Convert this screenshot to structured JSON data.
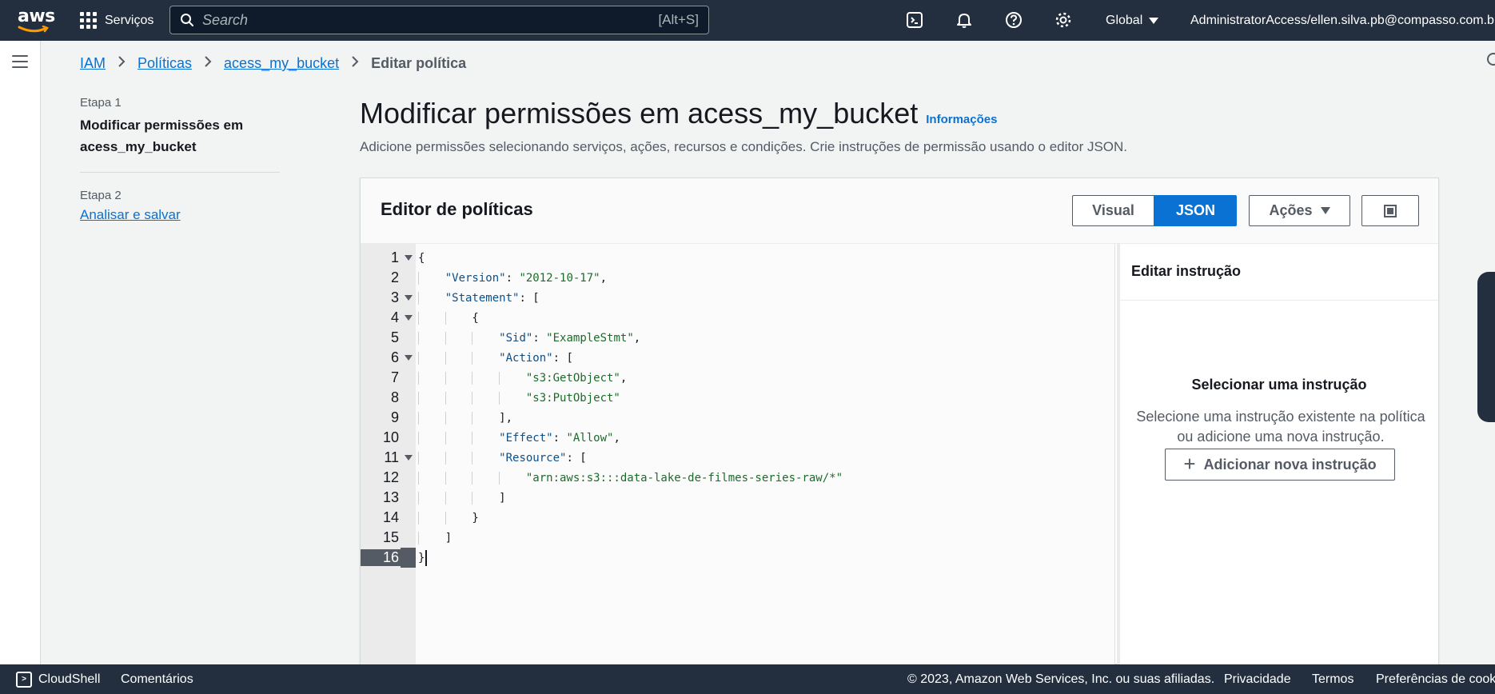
{
  "topnav": {
    "logo_text": "aws",
    "services_label": "Serviços",
    "search_placeholder": "Search",
    "search_shortcut": "[Alt+S]",
    "region_label": "Global",
    "account_label": "AdministratorAccess/ellen.silva.pb@compasso.com.br"
  },
  "breadcrumb": {
    "items": [
      "IAM",
      "Políticas",
      "acess_my_bucket"
    ],
    "current": "Editar política"
  },
  "steps": [
    {
      "label": "Etapa 1",
      "title": "Modificar permissões em acess_my_bucket"
    },
    {
      "label": "Etapa 2",
      "title": "Analisar e salvar"
    }
  ],
  "page": {
    "title": "Modificar permissões em acess_my_bucket",
    "info_link": "Informações",
    "description": "Adicione permissões selecionando serviços, ações, recursos e condições. Crie instruções de permissão usando o editor JSON."
  },
  "editor": {
    "title": "Editor de políticas",
    "tabs": [
      "Visual",
      "JSON"
    ],
    "active_tab": "JSON",
    "actions_label": "Ações",
    "active_line": 16,
    "lines": [
      "{",
      "    \"Version\": \"2012-10-17\",",
      "    \"Statement\": [",
      "        {",
      "            \"Sid\": \"ExampleStmt\",",
      "            \"Action\": [",
      "                \"s3:GetObject\",",
      "                \"s3:PutObject\"",
      "            ],",
      "            \"Effect\": \"Allow\",",
      "            \"Resource\": [",
      "                \"arn:aws:s3:::data-lake-de-filmes-series-raw/*\"",
      "            ]",
      "        }",
      "    ]",
      "}"
    ],
    "fold_lines": [
      1,
      3,
      4,
      6,
      11
    ]
  },
  "side_panel": {
    "title": "Editar instrução",
    "empty_title": "Selecionar uma instrução",
    "empty_description": "Selecione uma instrução existente na política ou adicione uma nova instrução.",
    "add_button": "Adicionar nova instrução"
  },
  "footer": {
    "cloudshell": "CloudShell",
    "feedback": "Comentários",
    "copyright": "© 2023, Amazon Web Services, Inc. ou suas afiliadas.",
    "privacy": "Privacidade",
    "terms": "Termos",
    "cookies": "Preferências de cookies"
  },
  "colors": {
    "nav_bg": "#232f3e",
    "link": "#0972d3",
    "primary_button": "#0972d3",
    "page_bg": "#f2f3f3"
  },
  "icons": [
    "aws-logo",
    "grid-icon",
    "search-icon",
    "cloudshell-icon",
    "bell-icon",
    "help-icon",
    "gear-icon",
    "hamburger-icon",
    "chevron-right-icon",
    "caret-down-icon",
    "panel-icon",
    "plus-icon",
    "fold-icon"
  ]
}
